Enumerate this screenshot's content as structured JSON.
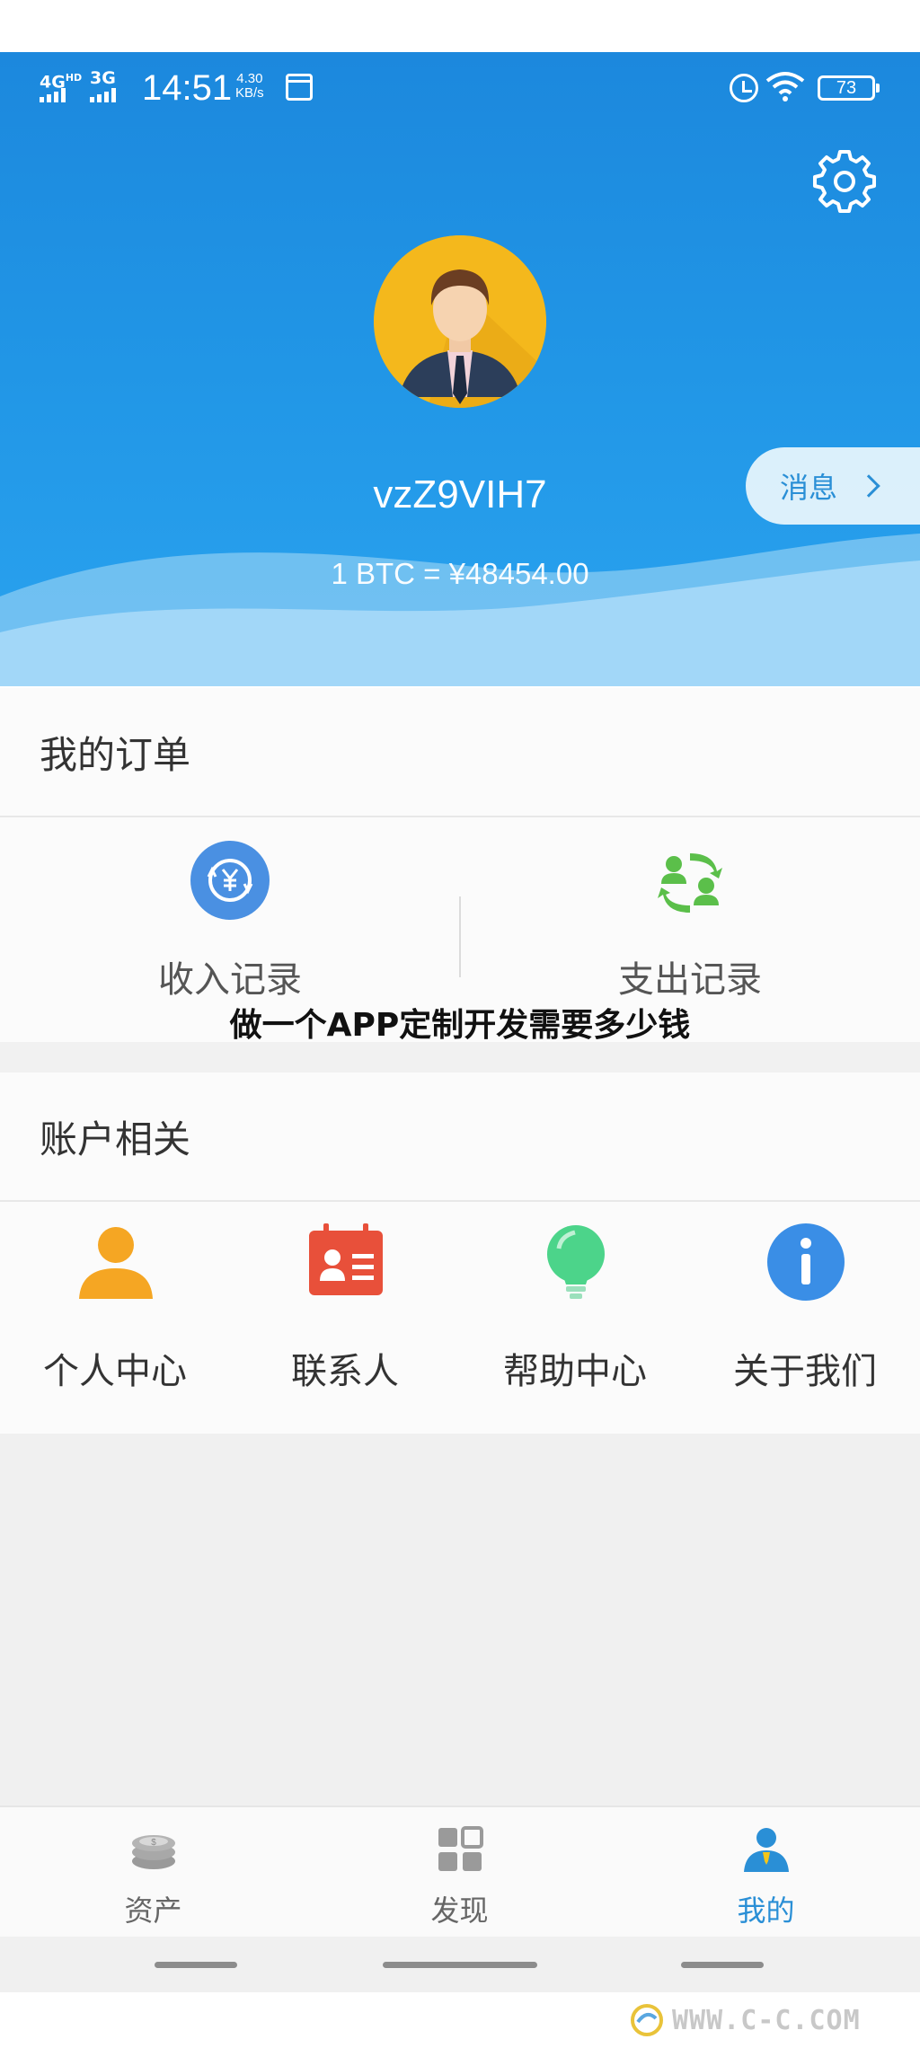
{
  "status_bar": {
    "network_1": "4G",
    "network_1_sup": "HD",
    "network_2": "3G",
    "time": "14:51",
    "speed_value": "4.30",
    "speed_unit": "KB/s",
    "battery": "73"
  },
  "profile": {
    "username": "vzZ9VIH7",
    "btc_rate": "1 BTC = ¥48454.00",
    "message_label": "消息"
  },
  "orders": {
    "title": "我的订单",
    "items": [
      {
        "label": "收入记录",
        "icon": "income-record-icon"
      },
      {
        "label": "支出记录",
        "icon": "expense-record-icon"
      }
    ]
  },
  "banner_text": "做一个APP定制开发需要多少钱",
  "account": {
    "title": "账户相关",
    "items": [
      {
        "label": "个人中心",
        "icon": "person-icon"
      },
      {
        "label": "联系人",
        "icon": "contact-card-icon"
      },
      {
        "label": "帮助中心",
        "icon": "lightbulb-icon"
      },
      {
        "label": "关于我们",
        "icon": "info-icon"
      }
    ]
  },
  "tabbar": {
    "items": [
      {
        "label": "资产",
        "icon": "coins-icon",
        "active": false
      },
      {
        "label": "发现",
        "icon": "grid-icon",
        "active": false
      },
      {
        "label": "我的",
        "icon": "user-icon",
        "active": true
      }
    ]
  },
  "watermark": "WWW.C-C.COM",
  "colors": {
    "primary": "#1c88dd",
    "accent_text": "#2a8fd6",
    "income_icon": "#4a90e2",
    "expense_icon": "#5bbf4a",
    "person_icon": "#f5a623",
    "contact_icon": "#e8503a",
    "help_icon": "#4cd48a",
    "about_icon": "#3a8ee6"
  }
}
